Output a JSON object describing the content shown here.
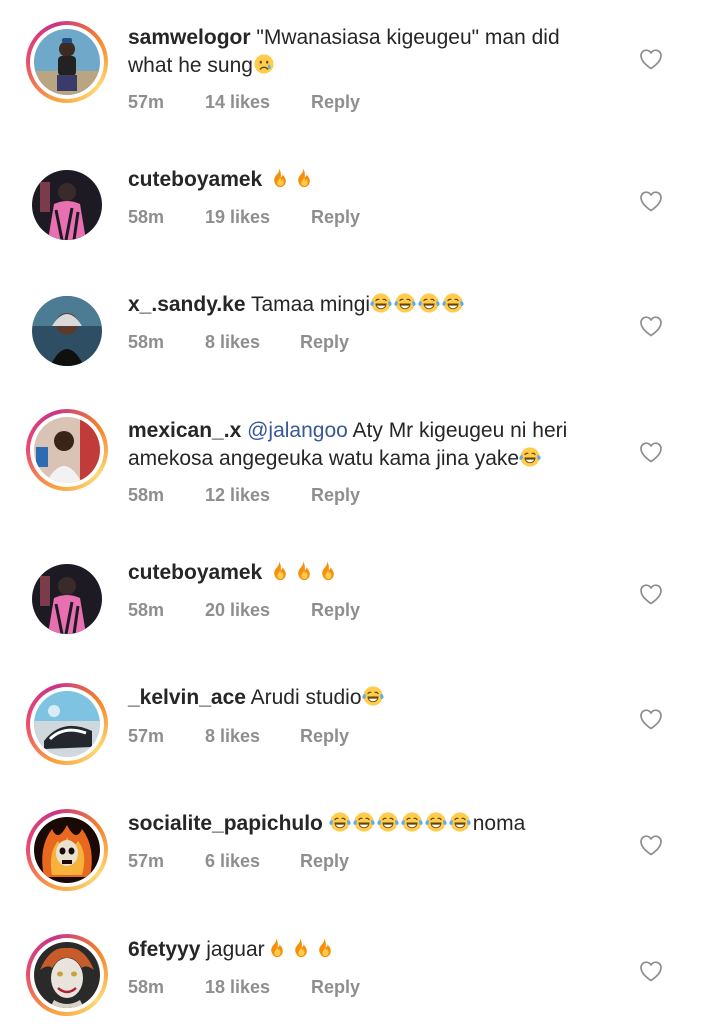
{
  "comments": [
    {
      "username": "samwelogor",
      "text_line1": "\"Mwanasiasa kigeugeu\" man did",
      "text_line2": "what he sung",
      "emoji": "sad-face",
      "time": "57m",
      "likes": "14 likes",
      "reply": "Reply",
      "story_ring": true
    },
    {
      "username": "cuteboyamek",
      "text": "",
      "emoji": "fire x2",
      "time": "58m",
      "likes": "19 likes",
      "reply": "Reply",
      "story_ring": false
    },
    {
      "username": "x_.sandy.ke",
      "text": "Tamaa mingi",
      "emoji": "laughing-tears x4",
      "time": "58m",
      "likes": "8 likes",
      "reply": "Reply",
      "story_ring": false
    },
    {
      "username": "mexican_.x",
      "mention": "@jalangoo",
      "text_line1": "Aty Mr kigeugeu ni heri",
      "text_line2": "amekosa angegeuka watu kama jina yake",
      "emoji": "laughing-tears",
      "time": "58m",
      "likes": "12 likes",
      "reply": "Reply",
      "story_ring": true
    },
    {
      "username": "cuteboyamek",
      "text": "",
      "emoji": "fire x3",
      "time": "58m",
      "likes": "20 likes",
      "reply": "Reply",
      "story_ring": false
    },
    {
      "username": "_kelvin_ace",
      "text": "Arudi studio",
      "emoji": "laughing-tears",
      "time": "57m",
      "likes": "8 likes",
      "reply": "Reply",
      "story_ring": true
    },
    {
      "username": "socialite_papichulo",
      "text": "noma",
      "emoji": "laughing-tears x6",
      "time": "57m",
      "likes": "6 likes",
      "reply": "Reply",
      "story_ring": true
    },
    {
      "username": "6fetyyy",
      "text": "jaguar",
      "emoji": "fire x3",
      "time": "58m",
      "likes": "18 likes",
      "reply": "Reply",
      "story_ring": true
    }
  ],
  "colors": {
    "text": "#262626",
    "meta": "#8e8e8e",
    "mention": "#385898",
    "heart_outline": "#8e8e8e"
  },
  "icons": {
    "like": "heart-outline-icon",
    "fire": "fire-emoji",
    "laugh": "laughing-tears-emoji",
    "sad": "sad-face-emoji"
  }
}
